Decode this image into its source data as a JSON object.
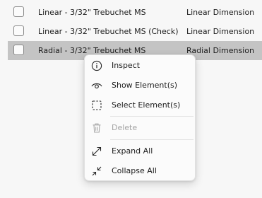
{
  "rows": [
    {
      "name": "Linear - 3/32\" Trebuchet MS",
      "type": "Linear Dimension",
      "selected": false
    },
    {
      "name": "Linear - 3/32\" Trebuchet MS (Check)",
      "type": "Linear Dimension",
      "selected": false
    },
    {
      "name": "Radial - 3/32\" Trebuchet MS",
      "type": "Radial Dimension",
      "selected": true
    }
  ],
  "context_menu": {
    "inspect": {
      "label": "Inspect",
      "icon": "info-icon"
    },
    "show_elements": {
      "label": "Show Element(s)",
      "icon": "eye-icon"
    },
    "select_elements": {
      "label": "Select Element(s)",
      "icon": "dashed-select-icon"
    },
    "delete": {
      "label": "Delete",
      "icon": "trash-icon",
      "disabled": true
    },
    "expand_all": {
      "label": "Expand All",
      "icon": "expand-icon"
    },
    "collapse_all": {
      "label": "Collapse All",
      "icon": "collapse-icon"
    }
  },
  "colors": {
    "background": "#f7f7f7",
    "selected_row": "#c4c4c4",
    "menu_background": "#fbfbfb",
    "disabled_text": "#a3a3a3"
  }
}
